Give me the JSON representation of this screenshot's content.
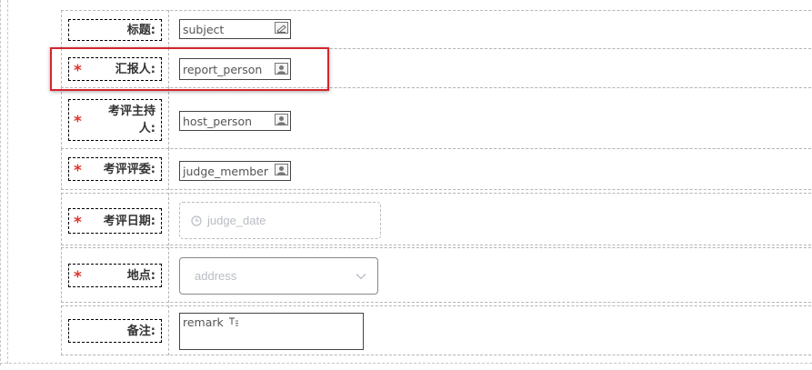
{
  "form": {
    "rows": [
      {
        "label": "标题:",
        "required": false,
        "field_value": "subject",
        "field_icon": "edit-icon"
      },
      {
        "label": "汇报人:",
        "required": true,
        "field_value": "report_person",
        "field_icon": "user-icon"
      },
      {
        "label": "考评主持人:",
        "required": true,
        "field_value": "host_person",
        "field_icon": "user-icon"
      },
      {
        "label": "考评评委:",
        "required": true,
        "field_value": "judge_member",
        "field_icon": "user-icon"
      },
      {
        "label": "考评日期:",
        "required": true,
        "placeholder": "judge_date",
        "field_icon": "clock-icon"
      },
      {
        "label": "地点:",
        "required": true,
        "placeholder": "address",
        "field_icon": "chevron-down-icon"
      },
      {
        "label": "备注:",
        "required": false,
        "field_value": "remark",
        "field_icon": "text-icon"
      }
    ],
    "required_mark": "*",
    "highlighted_row": "汇报人:"
  },
  "colors": {
    "required": "#e0322c",
    "highlight": "#d3262e",
    "placeholder": "#b9bcc4"
  }
}
